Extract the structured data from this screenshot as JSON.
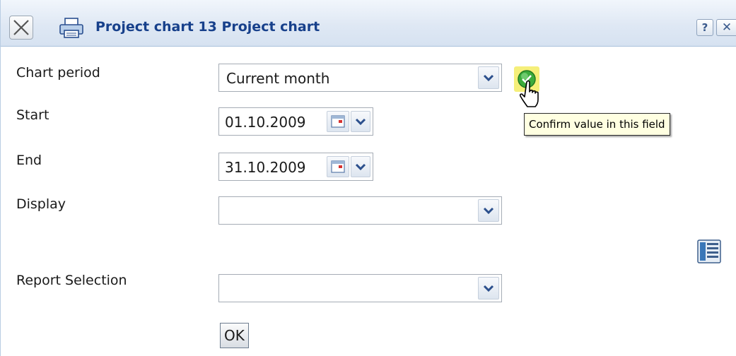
{
  "window": {
    "title": "Project chart 13 Project chart",
    "help_label": "?",
    "close_label": "✕"
  },
  "form": {
    "chart_period": {
      "label": "Chart period",
      "value": "Current month"
    },
    "start": {
      "label": "Start",
      "value": "01.10.2009"
    },
    "end": {
      "label": "End",
      "value": "31.10.2009"
    },
    "display": {
      "label": "Display",
      "value": ""
    },
    "report_selection": {
      "label": "Report Selection",
      "value": ""
    },
    "ok_label": "OK"
  },
  "tooltip": {
    "text": "Confirm value in this field"
  },
  "icons": {
    "close": "close-x-icon",
    "print": "printer-icon",
    "confirm": "confirm-check-icon",
    "calendar": "calendar-icon",
    "dropdown": "chevron-down-icon",
    "report": "report-list-icon",
    "cursor": "hand-cursor-icon"
  },
  "colors": {
    "title_text": "#17408b",
    "titlebar_top": "#f1f6fc",
    "titlebar_bottom": "#d6e2f1",
    "tooltip_bg": "#ffffe1",
    "confirm_highlight": "#f5ef7a",
    "confirm_green": "#3cab3c",
    "chevron": "#2b4f8c"
  }
}
